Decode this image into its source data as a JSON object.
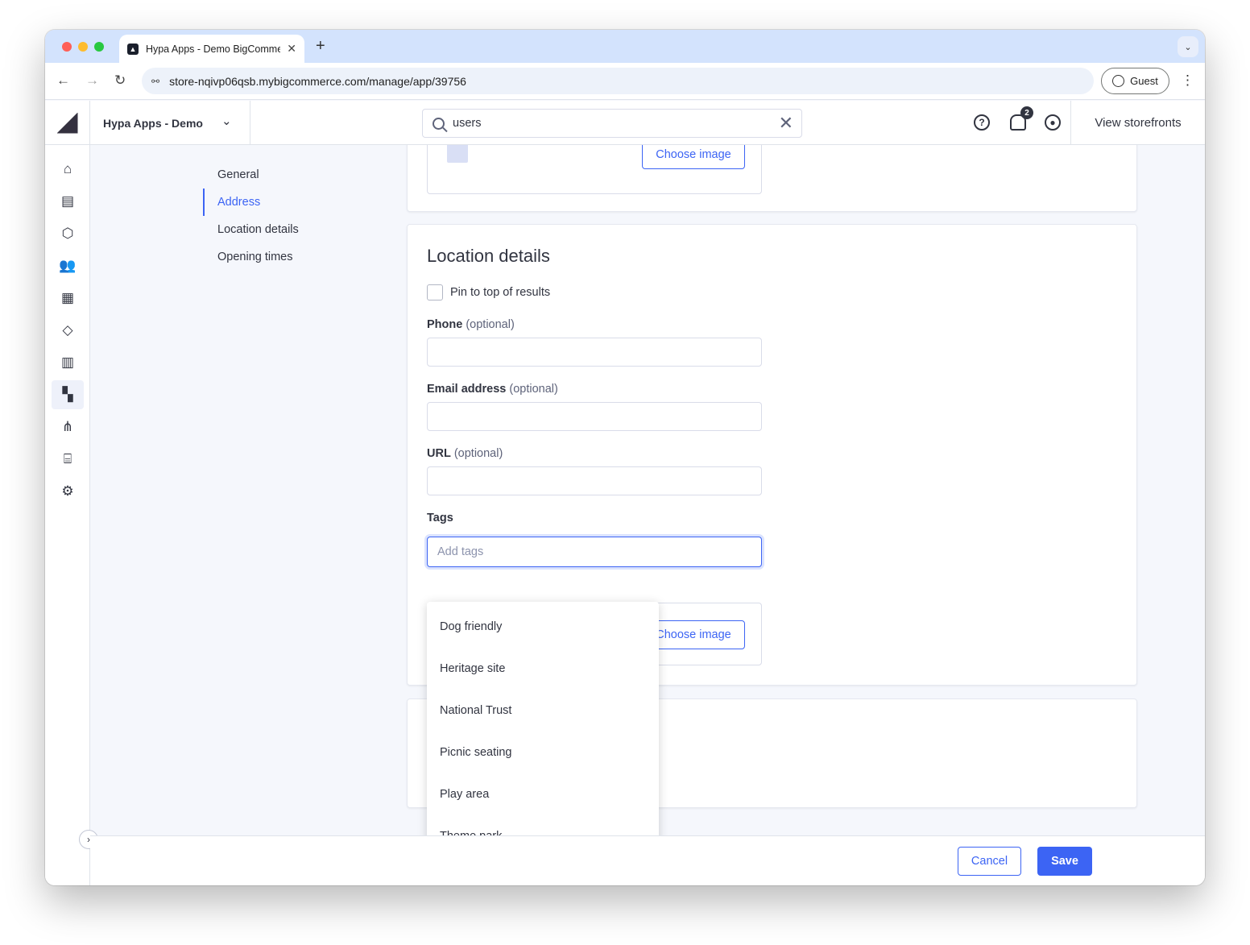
{
  "browser": {
    "tab_title": "Hypa Apps - Demo BigCommerce",
    "tab_close": "✕",
    "new_tab": "+",
    "url": "store-nqivp06qsb.mybigcommerce.com/manage/app/39756",
    "guest_label": "Guest",
    "back": "←",
    "forward": "→",
    "reload": "↻",
    "menu": "⋮",
    "tab_menu": "⌄"
  },
  "header": {
    "store_name": "Hypa Apps - Demo",
    "store_chevron": "⌄",
    "search_value": "users",
    "search_clear": "✕",
    "help": "?",
    "notification_count": "2",
    "view_storefronts": "View storefronts"
  },
  "rail": {
    "icons": [
      "home-icon",
      "orders-icon",
      "products-icon",
      "customers-icon",
      "storefront-icon",
      "marketing-icon",
      "analytics-icon",
      "apps-icon",
      "channels-icon",
      "finance-icon",
      "settings-icon"
    ],
    "glyphs": [
      "⌂",
      "▤",
      "⬡",
      "👥",
      "▦",
      "◇",
      "▥",
      "▚",
      "⋔",
      "⌸",
      "⚙"
    ],
    "expand": "›"
  },
  "subnav": {
    "items": [
      "General",
      "Address",
      "Location details",
      "Opening times"
    ],
    "active": "Address"
  },
  "top_card": {
    "choose_image": "Choose image"
  },
  "location_details": {
    "title": "Location details",
    "pin_label": "Pin to top of results",
    "phone_label": "Phone",
    "email_label": "Email address",
    "url_label": "URL",
    "optional": "(optional)",
    "tags_label": "Tags",
    "tags_placeholder": "Add tags",
    "choose_image": "Choose image"
  },
  "tag_options": [
    "Dog friendly",
    "Heritage site",
    "National Trust",
    "Picnic seating",
    "Play area",
    "Theme park"
  ],
  "footer": {
    "cancel": "Cancel",
    "save": "Save"
  },
  "colors": {
    "accent": "#3c64f4",
    "text": "#313440"
  }
}
